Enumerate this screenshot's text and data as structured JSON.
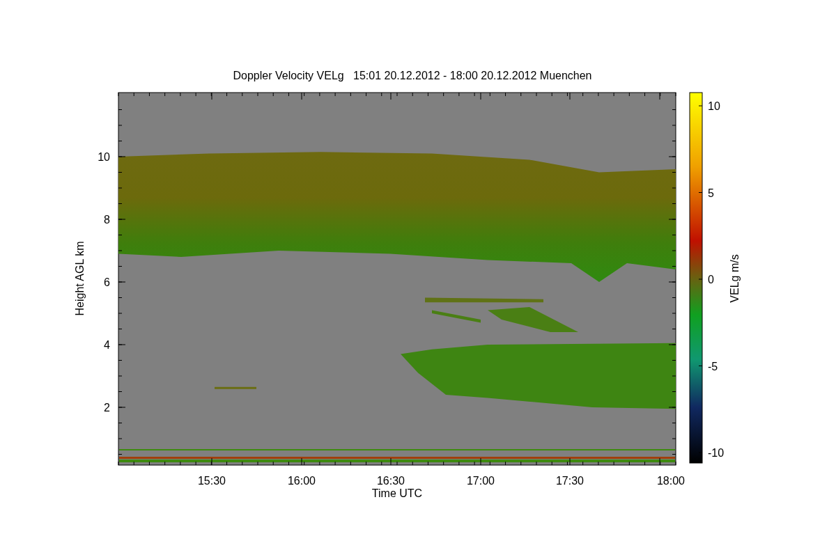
{
  "title": "Doppler Velocity VELg   15:01 20.12.2012 - 18:00 20.12.2012 Muenchen",
  "x_axis": {
    "label": "Time UTC",
    "ticks": [
      "15:30",
      "16:00",
      "16:30",
      "17:00",
      "17:30",
      "18:00"
    ]
  },
  "y_axis": {
    "label": "Height AGL km",
    "ticks": [
      "10",
      "8",
      "6",
      "4",
      "2"
    ]
  },
  "colorbar": {
    "label": "VELg m/s",
    "ticks": [
      "10",
      "5",
      "0",
      "-5",
      "-10"
    ]
  }
}
